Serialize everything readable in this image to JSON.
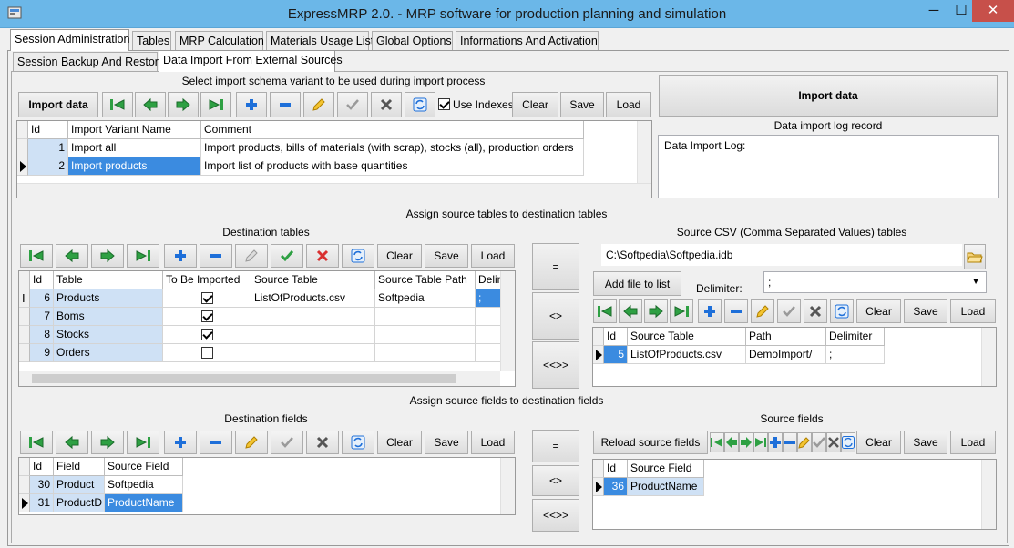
{
  "app": {
    "title": "ExpressMRP 2.0. - MRP software for production planning and simulation"
  },
  "window_controls": {
    "minimize": "─",
    "maximize": "☐",
    "close": "✕"
  },
  "main_tabs": [
    {
      "label": "Session Administration",
      "active": true
    },
    {
      "label": "Tables"
    },
    {
      "label": "MRP Calculation"
    },
    {
      "label": "Materials Usage List"
    },
    {
      "label": "Global Options"
    },
    {
      "label": "Informations And Activation"
    }
  ],
  "sub_tabs": [
    {
      "label": "Session Backup And Restore"
    },
    {
      "label": "Data Import From External Sources",
      "active": true
    }
  ],
  "schema": {
    "caption": "Select import schema variant to be used during import process",
    "import_button": "Import data",
    "use_indexes_label": "Use Indexes",
    "use_indexes_checked": true,
    "clear": "Clear",
    "save": "Save",
    "load": "Load",
    "columns": [
      "Id",
      "Import Variant Name",
      "Comment"
    ],
    "rows": [
      {
        "id": "1",
        "name": "Import all",
        "comment": "Import products, bills of materials (with scrap), stocks (all), production orders"
      },
      {
        "id": "2",
        "name": "Import products",
        "comment": "Import list of products with base quantities"
      }
    ]
  },
  "log": {
    "import_button": "Import data",
    "caption": "Data import log record",
    "text": "Data Import Log:"
  },
  "assign_tables_caption": "Assign source tables to destination tables",
  "dest_tables": {
    "caption": "Destination tables",
    "clear": "Clear",
    "save": "Save",
    "load": "Load",
    "columns": [
      "Id",
      "Table",
      "To Be Imported",
      "Source Table",
      "Source Table Path",
      "Delim"
    ],
    "rows": [
      {
        "id": "6",
        "table": "Products",
        "imported": true,
        "src": "ListOfProducts.csv",
        "path": "Softpedia",
        "delim": ";"
      },
      {
        "id": "7",
        "table": "Boms",
        "imported": true,
        "src": "",
        "path": "",
        "delim": ""
      },
      {
        "id": "8",
        "table": "Stocks",
        "imported": true,
        "src": "",
        "path": "",
        "delim": ""
      },
      {
        "id": "9",
        "table": "Orders",
        "imported": false,
        "src": "",
        "path": "",
        "delim": ""
      }
    ]
  },
  "middle_buttons_1": [
    "=",
    "<>",
    "<<>>"
  ],
  "source_tables": {
    "caption": "Source CSV (Comma Separated Values) tables",
    "path_value": "C:\\Softpedia\\Softpedia.idb",
    "add_file": "Add file to list",
    "delimiter_label": "Delimiter:",
    "delimiter_value": ";",
    "clear": "Clear",
    "save": "Save",
    "load": "Load",
    "columns": [
      "Id",
      "Source Table",
      "Path",
      "Delimiter"
    ],
    "rows": [
      {
        "id": "5",
        "table": "ListOfProducts.csv",
        "path": "DemoImport/",
        "delim": ";"
      }
    ]
  },
  "assign_fields_caption": "Assign source fields to destination fields",
  "dest_fields": {
    "caption": "Destination fields",
    "clear": "Clear",
    "save": "Save",
    "load": "Load",
    "columns": [
      "Id",
      "Field",
      "Source Field"
    ],
    "rows": [
      {
        "id": "30",
        "field": "Product",
        "src": "Softpedia"
      },
      {
        "id": "31",
        "field": "ProductD",
        "src": "ProductName"
      }
    ]
  },
  "middle_buttons_2": [
    "=",
    "<>",
    "<<>>"
  ],
  "source_fields": {
    "caption": "Source fields",
    "reload": "Reload source fields",
    "clear": "Clear",
    "save": "Save",
    "load": "Load",
    "columns": [
      "Id",
      "Source Field"
    ],
    "rows": [
      {
        "id": "36",
        "field": "ProductName"
      }
    ]
  },
  "colors": {
    "titlebar": "#6bb7e8",
    "selection": "#3b8be0",
    "cell_blue": "#cfe1f5",
    "nav_green": "#2ea043",
    "add_blue": "#1e6fd9",
    "delete_red": "#d93030"
  },
  "icons": [
    "app-icon",
    "first-record-icon",
    "prior-record-icon",
    "next-record-icon",
    "last-record-icon",
    "add-record-icon",
    "delete-record-icon",
    "edit-record-icon",
    "post-edit-icon",
    "cancel-edit-icon",
    "refresh-icon",
    "open-folder-icon"
  ]
}
